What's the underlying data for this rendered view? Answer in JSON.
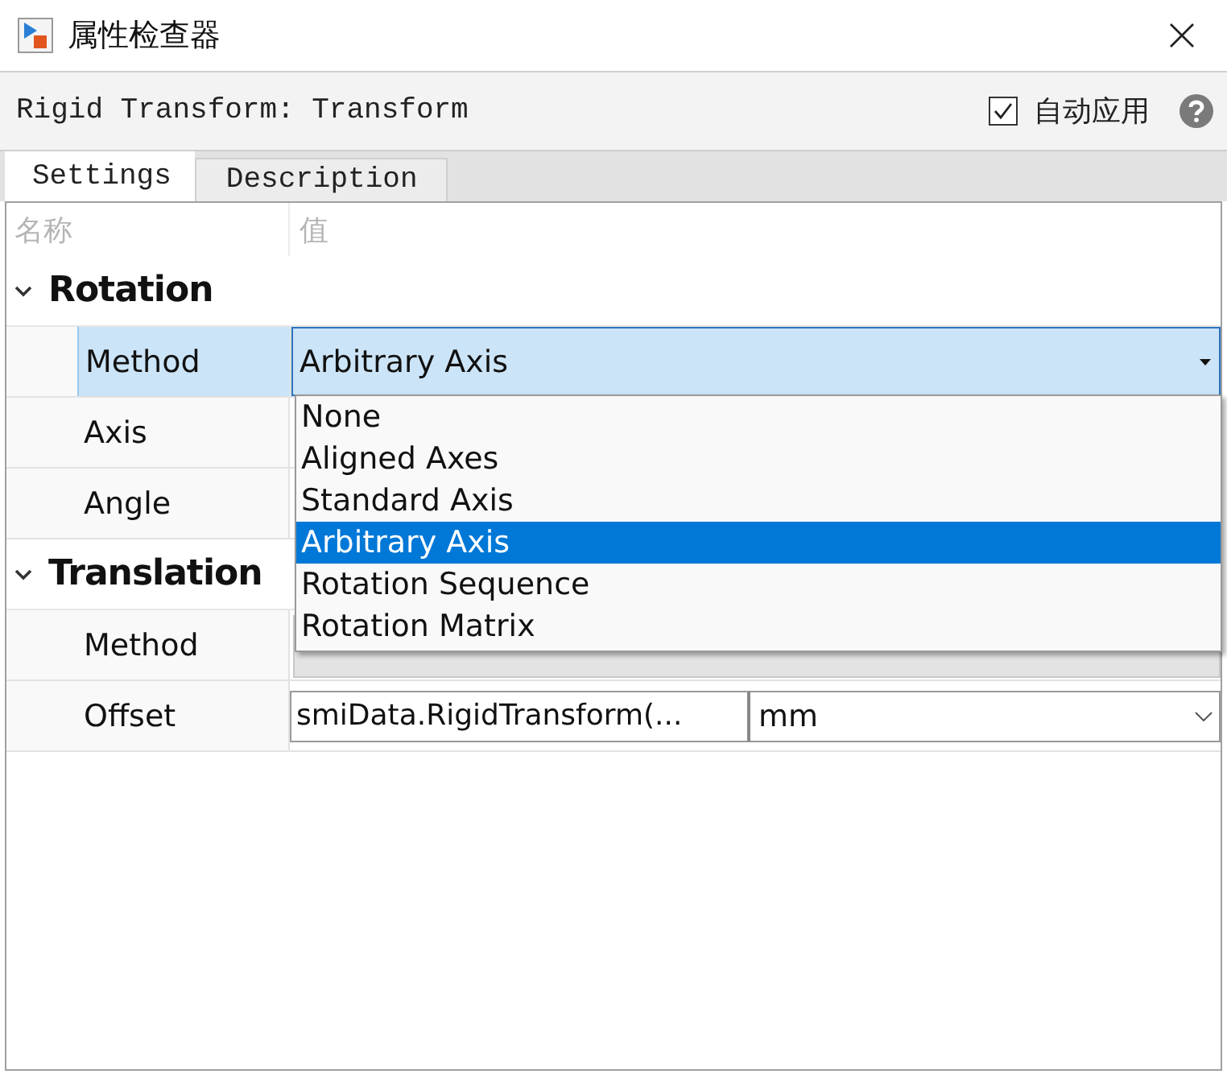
{
  "window": {
    "title": "属性检查器"
  },
  "header": {
    "object": "Rigid Transform: Transform",
    "auto_apply": {
      "label": "自动应用",
      "checked": true
    }
  },
  "tabs": [
    {
      "label": "Settings",
      "selected": true
    },
    {
      "label": "Description",
      "selected": false
    }
  ],
  "grid": {
    "columns": [
      "名称",
      "值"
    ],
    "groups": [
      {
        "name": "Rotation",
        "expanded": true,
        "properties": [
          {
            "name": "Method",
            "selected": true,
            "kind": "combo",
            "value": "Arbitrary Axis"
          },
          {
            "name": "Axis",
            "selected": false,
            "kind": "covered"
          },
          {
            "name": "Angle",
            "selected": false,
            "kind": "covered"
          }
        ]
      },
      {
        "name": "Translation",
        "expanded": true,
        "properties": [
          {
            "name": "Method",
            "selected": false,
            "kind": "readonly"
          },
          {
            "name": "Offset",
            "selected": false,
            "kind": "value_unit",
            "value": "smiData.RigidTransform(...",
            "unit": "mm"
          }
        ]
      }
    ]
  },
  "dropdown": {
    "options": [
      {
        "label": "None",
        "selected": false
      },
      {
        "label": "Aligned Axes",
        "selected": false
      },
      {
        "label": "Standard Axis",
        "selected": false
      },
      {
        "label": "Arbitrary Axis",
        "selected": true
      },
      {
        "label": "Rotation Sequence",
        "selected": false
      },
      {
        "label": "Rotation Matrix",
        "selected": false
      }
    ]
  }
}
